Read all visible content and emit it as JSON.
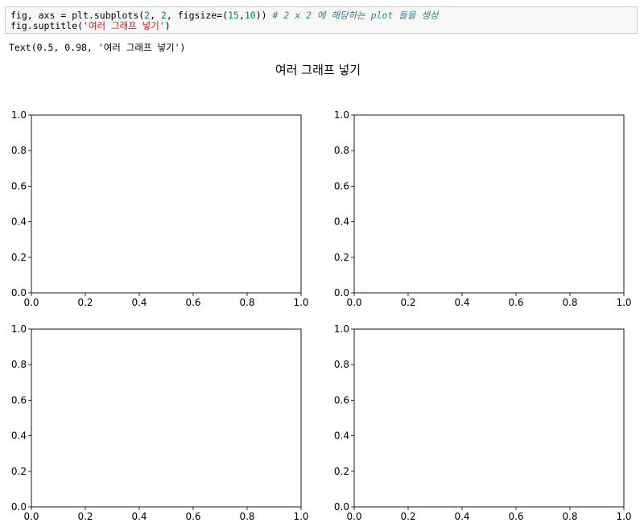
{
  "code_cell": {
    "line1_a": "fig, axs = plt.subplots(",
    "line1_num1": "2",
    "line1_sep1": ", ",
    "line1_num2": "2",
    "line1_b": ", figsize=(",
    "line1_num3": "15",
    "line1_sep2": ",",
    "line1_num4": "10",
    "line1_c": ")) ",
    "line1_comment": "# 2 x 2 에 해당하는 plot 들을 생성",
    "line2_a": "fig.suptitle(",
    "line2_str": "'여러 그래프 넣기'",
    "line2_b": ")"
  },
  "output_text": "Text(0.5, 0.98, '여러 그래프 넣기')",
  "chart_data": {
    "type": "subplots-grid",
    "suptitle": "여러 그래프 넣기",
    "rows": 2,
    "cols": 2,
    "axes": [
      {
        "xlim": [
          0,
          1
        ],
        "ylim": [
          0,
          1
        ],
        "series": []
      },
      {
        "xlim": [
          0,
          1
        ],
        "ylim": [
          0,
          1
        ],
        "series": []
      },
      {
        "xlim": [
          0,
          1
        ],
        "ylim": [
          0,
          1
        ],
        "series": []
      },
      {
        "xlim": [
          0,
          1
        ],
        "ylim": [
          0,
          1
        ],
        "series": []
      }
    ],
    "xticks": [
      0.0,
      0.2,
      0.4,
      0.6,
      0.8,
      1.0
    ],
    "yticks": [
      0.0,
      0.2,
      0.4,
      0.6,
      0.8,
      1.0
    ],
    "tick_labels": [
      "0.0",
      "0.2",
      "0.4",
      "0.6",
      "0.8",
      "1.0"
    ]
  }
}
